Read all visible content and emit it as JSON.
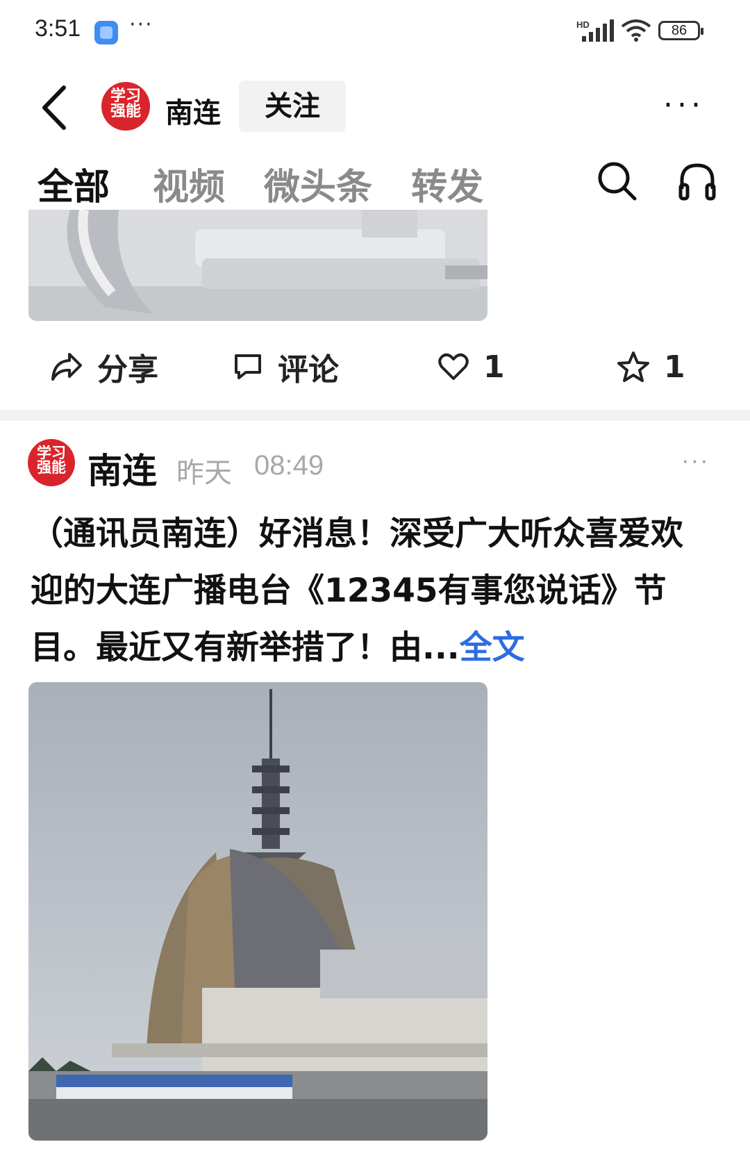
{
  "status_bar": {
    "time": "3:51",
    "more": "···",
    "network": "HD",
    "battery": "86"
  },
  "top_bar": {
    "account_name": "南连",
    "avatar_line1": "学习",
    "avatar_line2": "强能",
    "follow_label": "关注",
    "more": "···"
  },
  "tabs": [
    {
      "label": "全部",
      "active": true
    },
    {
      "label": "视频",
      "active": false
    },
    {
      "label": "微头条",
      "active": false
    },
    {
      "label": "转发",
      "active": false
    }
  ],
  "actions": {
    "share": "分享",
    "comment": "评论",
    "like_count": "1",
    "favorite_count": "1"
  },
  "post": {
    "avatar_line1": "学习",
    "avatar_line2": "强能",
    "author": "南连",
    "date": "昨天",
    "time": "08:49",
    "more": "···",
    "text": "（通讯员南连）好消息！深受广大听众喜爱欢迎的大连广播电台《12345有事您说话》节目。最近又有新举措了！由...",
    "read_more": "全文"
  },
  "colors": {
    "accent": "#2c6ce3",
    "avatar_red": "#d9242b",
    "muted": "#a8a8a8"
  }
}
